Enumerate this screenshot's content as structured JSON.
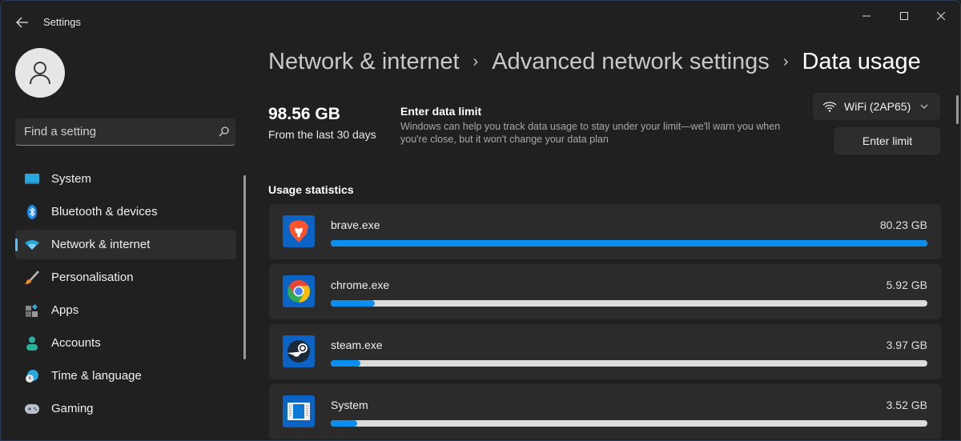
{
  "window": {
    "title": "Settings",
    "controls": {
      "minimize": "minimize",
      "maximize": "maximize",
      "close": "close"
    }
  },
  "sidebar": {
    "search": {
      "placeholder": "Find a setting",
      "value": ""
    },
    "items": [
      {
        "label": "System",
        "icon": "monitor-icon",
        "active": false
      },
      {
        "label": "Bluetooth & devices",
        "icon": "bluetooth-icon",
        "active": false
      },
      {
        "label": "Network & internet",
        "icon": "wifi-icon",
        "active": true
      },
      {
        "label": "Personalisation",
        "icon": "brush-icon",
        "active": false
      },
      {
        "label": "Apps",
        "icon": "apps-icon",
        "active": false
      },
      {
        "label": "Accounts",
        "icon": "person-icon",
        "active": false
      },
      {
        "label": "Time & language",
        "icon": "globe-clock-icon",
        "active": false
      },
      {
        "label": "Gaming",
        "icon": "gamepad-icon",
        "active": false
      }
    ]
  },
  "breadcrumb": {
    "items": [
      "Network & internet",
      "Advanced network settings"
    ],
    "current": "Data usage",
    "separator": "›"
  },
  "summary": {
    "total": "98.56 GB",
    "period": "From the last 30 days"
  },
  "data_limit": {
    "title": "Enter data limit",
    "description": "Windows can help you track data usage to stay under your limit—we'll warn you when you're close, but it won't change your data plan",
    "button_label": "Enter limit"
  },
  "network": {
    "selected": "WiFi (2AP65)"
  },
  "usage": {
    "title": "Usage statistics",
    "apps": [
      {
        "name": "brave.exe",
        "amount": "80.23 GB",
        "fraction": 1.0,
        "icon": "brave-icon"
      },
      {
        "name": "chrome.exe",
        "amount": "5.92 GB",
        "fraction": 0.074,
        "icon": "chrome-icon"
      },
      {
        "name": "steam.exe",
        "amount": "3.97 GB",
        "fraction": 0.049,
        "icon": "steam-icon"
      },
      {
        "name": "System",
        "amount": "3.52 GB",
        "fraction": 0.044,
        "icon": "system-window-icon"
      }
    ]
  },
  "colors": {
    "accent": "#0a8ff0",
    "nav_indicator": "#4cc2ff",
    "background": "#202020",
    "card": "#2b2b2b",
    "bar_track": "#dcdcdc"
  }
}
